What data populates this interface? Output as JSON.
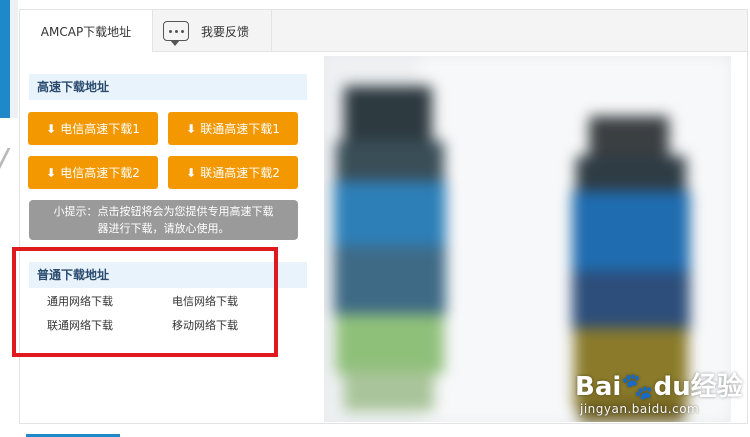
{
  "tabs": {
    "amcap_label": "AMCAP下载地址",
    "feedback_label": "我要反馈"
  },
  "fast_section": {
    "title": "高速下载地址",
    "buttons": [
      {
        "label": "电信高速下载1"
      },
      {
        "label": "联通高速下载1"
      },
      {
        "label": "电信高速下载2"
      },
      {
        "label": "联通高速下载2"
      }
    ],
    "tip_line1": "小提示：点击按钮将会为您提供专用高速下载",
    "tip_line2": "器进行下载，请放心使用。"
  },
  "normal_section": {
    "title": "普通下载地址",
    "links": [
      {
        "label": "通用网络下载"
      },
      {
        "label": "电信网络下载"
      },
      {
        "label": "联通网络下载"
      },
      {
        "label": "移动网络下载"
      }
    ]
  },
  "watermark": {
    "brand": "Bai",
    "brand_mid": "du",
    "brand_cn": "经验",
    "sub": "jingyan.baidu.com"
  },
  "colors": {
    "accent_orange": "#f39800",
    "header_bg": "#e8f3fc",
    "highlight_red": "#e0191e",
    "brand_blue": "#1e88c9"
  }
}
